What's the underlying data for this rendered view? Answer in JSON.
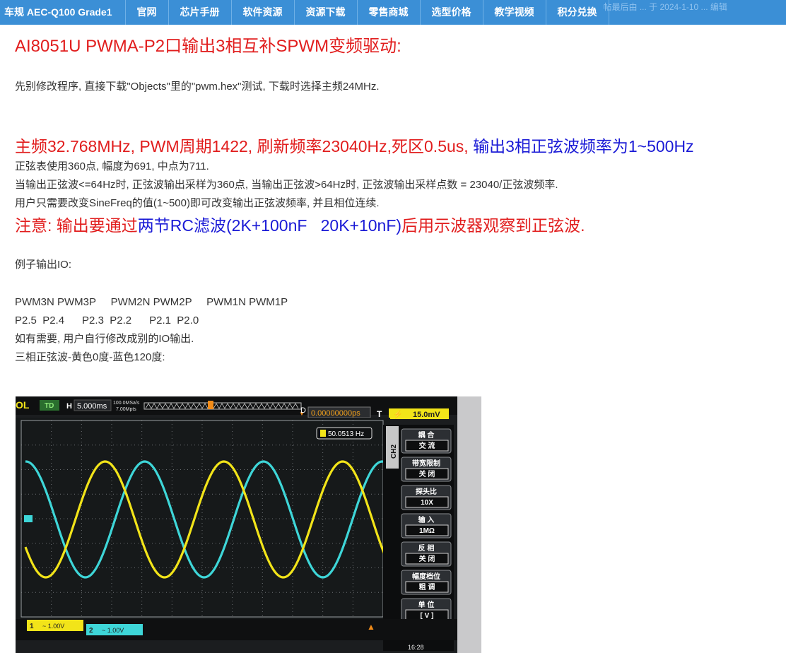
{
  "nav": {
    "brand": "车规 AEC-Q100 Grade1",
    "items": [
      "官网",
      "芯片手册",
      "软件资源",
      "资源下载",
      "零售商城",
      "选型价格",
      "教学视频",
      "积分兑换"
    ],
    "faint_text": "帖最后由 ... 于 2024-1-10 ... 编辑"
  },
  "content": {
    "title": "AI8051U  PWMA-P2口输出3相互补SPWM变频驱动:",
    "intro": "先别修改程序, 直接下载\"Objects\"里的\"pwm.hex\"测试, 下载时选择主频24MHz.",
    "spec_red": "主频32.768MHz, PWM周期1422, 刷新频率23040Hz,死区0.5us, ",
    "spec_blue": "输出3相正弦波频率为1~500Hz",
    "line1": "正弦表使用360点, 幅度为691, 中点为711.",
    "line2": "当输出正弦波<=64Hz时, 正弦波输出采样为360点, 当输出正弦波>64Hz时, 正弦波输出采样点数 = 23040/正弦波频率.",
    "line3": "用户只需要改变SineFreq的值(1~500)即可改变输出正弦波频率, 并且相位连续.",
    "note_red1": "注意: 输出要通过",
    "note_blue": "两节RC滤波(2K+100nF   20K+10nF)",
    "note_red2": "后用示波器观察到正弦波.",
    "io_heading": "例子输出IO:",
    "io_names": "PWM3N PWM3P     PWM2N PWM2P     PWM1N PWM1P",
    "io_pins": "P2.5  P2.4      P2.3  P2.2      P2.1  P2.0",
    "io_note": "如有需要, 用户自行修改成别的IO输出.",
    "waves_caption": "三相正弦波-黄色0度-蓝色120度:"
  },
  "scope": {
    "brand_fragment": "OL",
    "td": "TD",
    "h_label": "H",
    "timebase": "5.000ms",
    "sample_rate": "100.0MSa/s",
    "mem_depth": "7.00Mpts",
    "d_label": "D",
    "delay": "0.00000000ps",
    "t_label": "T",
    "trigger_level": "15.0mV",
    "frequency": "50.0513 Hz",
    "channel": "CH2",
    "menu": [
      {
        "label": "耦 合",
        "value": "交 流"
      },
      {
        "label": "带宽限制",
        "value": "关 闭"
      },
      {
        "label": "探头比",
        "value": "10X"
      },
      {
        "label": "输 入",
        "value": "1MΩ"
      },
      {
        "label": "反 相",
        "value": "关 闭"
      },
      {
        "label": "幅度档位",
        "value": "粗 调"
      },
      {
        "label": "单 位",
        "value": "[ V ]"
      }
    ],
    "ch1_scale": "~ 1.00V",
    "ch2_scale": "~ 1.00V",
    "ch1_num": "1",
    "ch2_num": "2",
    "time": "16:28",
    "colors": {
      "ch1": "#f2e419",
      "ch2": "#3ed6d8",
      "screen": "#16191a"
    }
  }
}
